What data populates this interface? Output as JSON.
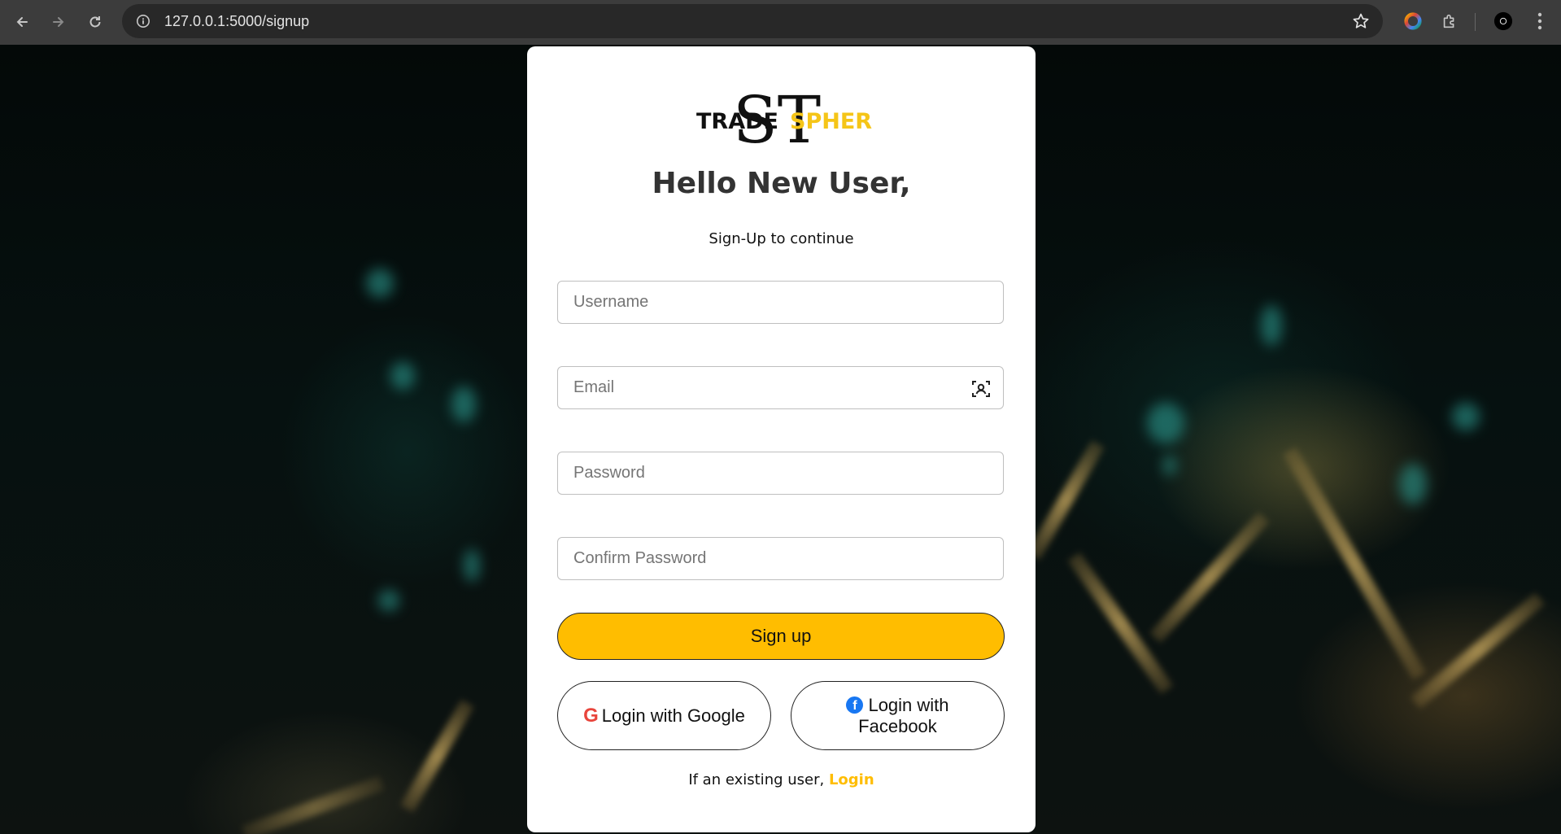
{
  "browser": {
    "url": "127.0.0.1:5000/signup",
    "icons": [
      "back-icon",
      "forward-icon",
      "reload-icon",
      "site-info-icon",
      "bookmark-star-icon",
      "color-extension-icon",
      "extensions-puzzle-icon",
      "profile-avatar",
      "menu-kebab-icon"
    ]
  },
  "logo": {
    "letters": "ST",
    "word_left": "TRADE",
    "word_right": "SPHERE",
    "accent_color": "#f5c518"
  },
  "form": {
    "greeting": "Hello New User,",
    "subtitle": "Sign-Up to continue",
    "username_placeholder": "Username",
    "email_placeholder": "Email",
    "password_placeholder": "Password",
    "confirm_password_placeholder": "Confirm Password",
    "signup_label": "Sign up",
    "google_label": "Login with Google",
    "google_letter": "G",
    "facebook_label_line1": "Login with",
    "facebook_label_line2": "Facebook",
    "facebook_letter": "f",
    "existing_text": "If an existing user, ",
    "login_link": "Login"
  },
  "colors": {
    "primary": "#ffbd00",
    "google_red": "#e8453c",
    "facebook_blue": "#1877f2"
  }
}
